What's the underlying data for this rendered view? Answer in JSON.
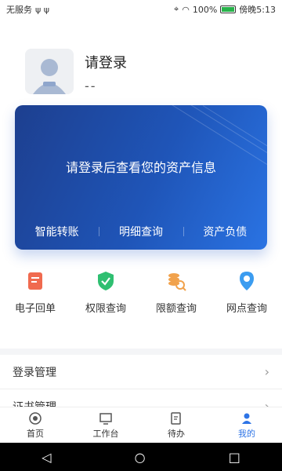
{
  "status": {
    "carrier": "无服务",
    "battery": "100%",
    "time": "傍晚5:13"
  },
  "profile": {
    "title": "请登录",
    "subtitle": "--"
  },
  "asset_card": {
    "message": "请登录后查看您的资产信息",
    "actions": [
      "智能转账",
      "明细查询",
      "资产负债"
    ]
  },
  "quick_actions": [
    {
      "label": "电子回单",
      "icon": "receipt-icon"
    },
    {
      "label": "权限查询",
      "icon": "shield-check-icon"
    },
    {
      "label": "限额查询",
      "icon": "coin-search-icon"
    },
    {
      "label": "网点查询",
      "icon": "location-pin-icon"
    }
  ],
  "menu": [
    {
      "label": "登录管理"
    },
    {
      "label": "证书管理"
    }
  ],
  "tabs": [
    {
      "label": "首页",
      "icon": "home-icon"
    },
    {
      "label": "工作台",
      "icon": "monitor-icon"
    },
    {
      "label": "待办",
      "icon": "todo-icon"
    },
    {
      "label": "我的",
      "icon": "profile-icon"
    }
  ],
  "colors": {
    "accent": "#2e74e6",
    "card_start": "#1d3f8f",
    "card_end": "#2a73e3"
  }
}
